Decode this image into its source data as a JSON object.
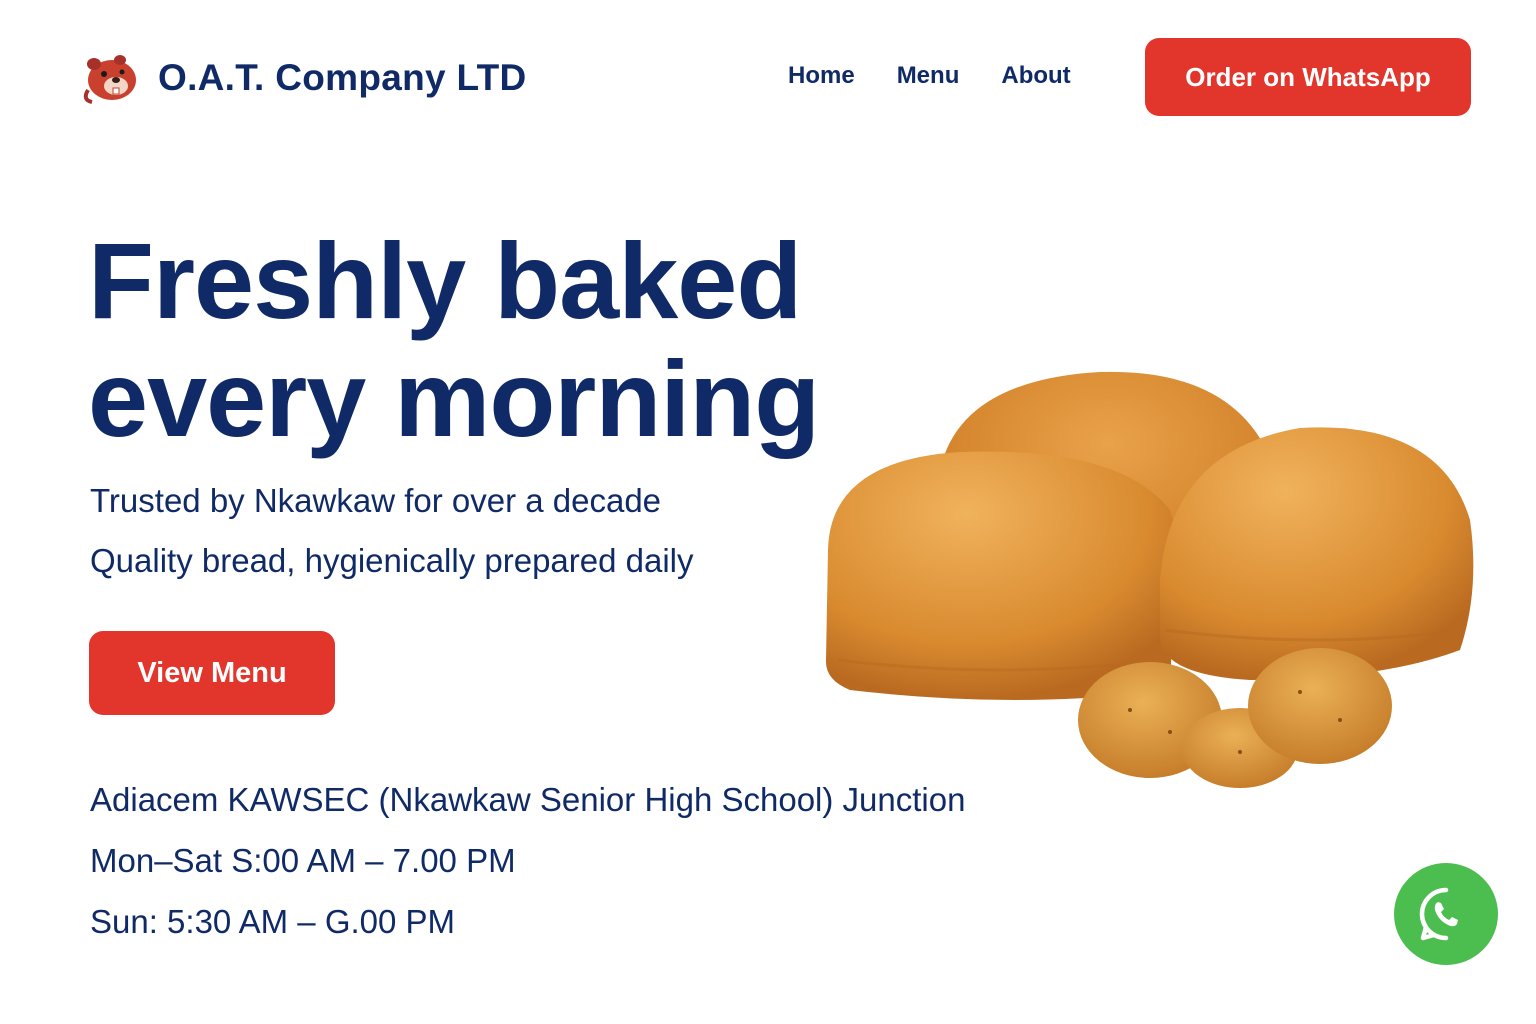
{
  "header": {
    "brand_name": "O.A.T. Company LTD",
    "logo_icon": "beaver-mascot-icon",
    "nav": [
      {
        "label": "Home"
      },
      {
        "label": "Menu"
      },
      {
        "label": "About"
      }
    ],
    "cta_label": "Order on WhatsApp"
  },
  "hero": {
    "title_line1": "Freshly baked",
    "title_line2": "every morning",
    "tagline1": "Trusted by Nkawkaw for over a decade",
    "tagline2": "Quality bread, hygienically prepared daily",
    "button_label": "View Menu",
    "image_icon": "bread-loaves-image"
  },
  "info": {
    "location": "Adiacem KAWSEC (Nkawkaw Senior High School) Junction",
    "hours_weekday": "Mon–Sat S:00 AM – 7.00 PM",
    "hours_sunday": "Sun: 5:30 AM – G.00 PM"
  },
  "floating": {
    "icon": "whatsapp-icon"
  },
  "colors": {
    "primary_text": "#0f2a66",
    "accent_red": "#e2352b",
    "whatsapp_green": "#4cbd4f",
    "bread_crust": "#d98a2f"
  }
}
